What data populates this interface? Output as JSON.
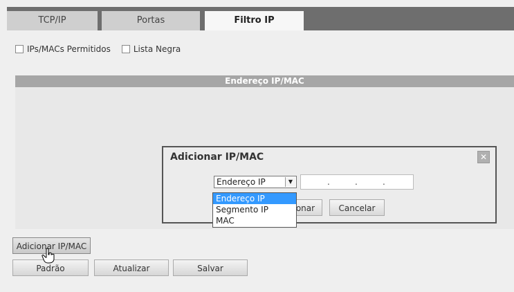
{
  "tabs": [
    {
      "label": "TCP/IP",
      "active": false
    },
    {
      "label": "Portas",
      "active": false
    },
    {
      "label": "Filtro IP",
      "active": true
    }
  ],
  "filters": {
    "allowed_label": "IPs/MACs Permitidos",
    "blacklist_label": "Lista Negra",
    "allowed_checked": false,
    "blacklist_checked": false
  },
  "table": {
    "header": "Endereço IP/MAC"
  },
  "dialog": {
    "title": "Adicionar IP/MAC",
    "type_selected": "Endereço IP",
    "ip_value": ". . .",
    "add_button": "Adicionar",
    "cancel_button": "Cancelar"
  },
  "dropdown": {
    "options": [
      "Endereço IP",
      "Segmento IP",
      "MAC"
    ],
    "selected": "Endereço IP"
  },
  "buttons": {
    "add_ip_mac": "Adicionar IP/MAC",
    "default": "Padrão",
    "refresh": "Atualizar",
    "save": "Salvar"
  },
  "colors": {
    "tab_bar": "#6e6e6e",
    "header_bg": "#a6a6a6",
    "selection": "#3399ff"
  }
}
